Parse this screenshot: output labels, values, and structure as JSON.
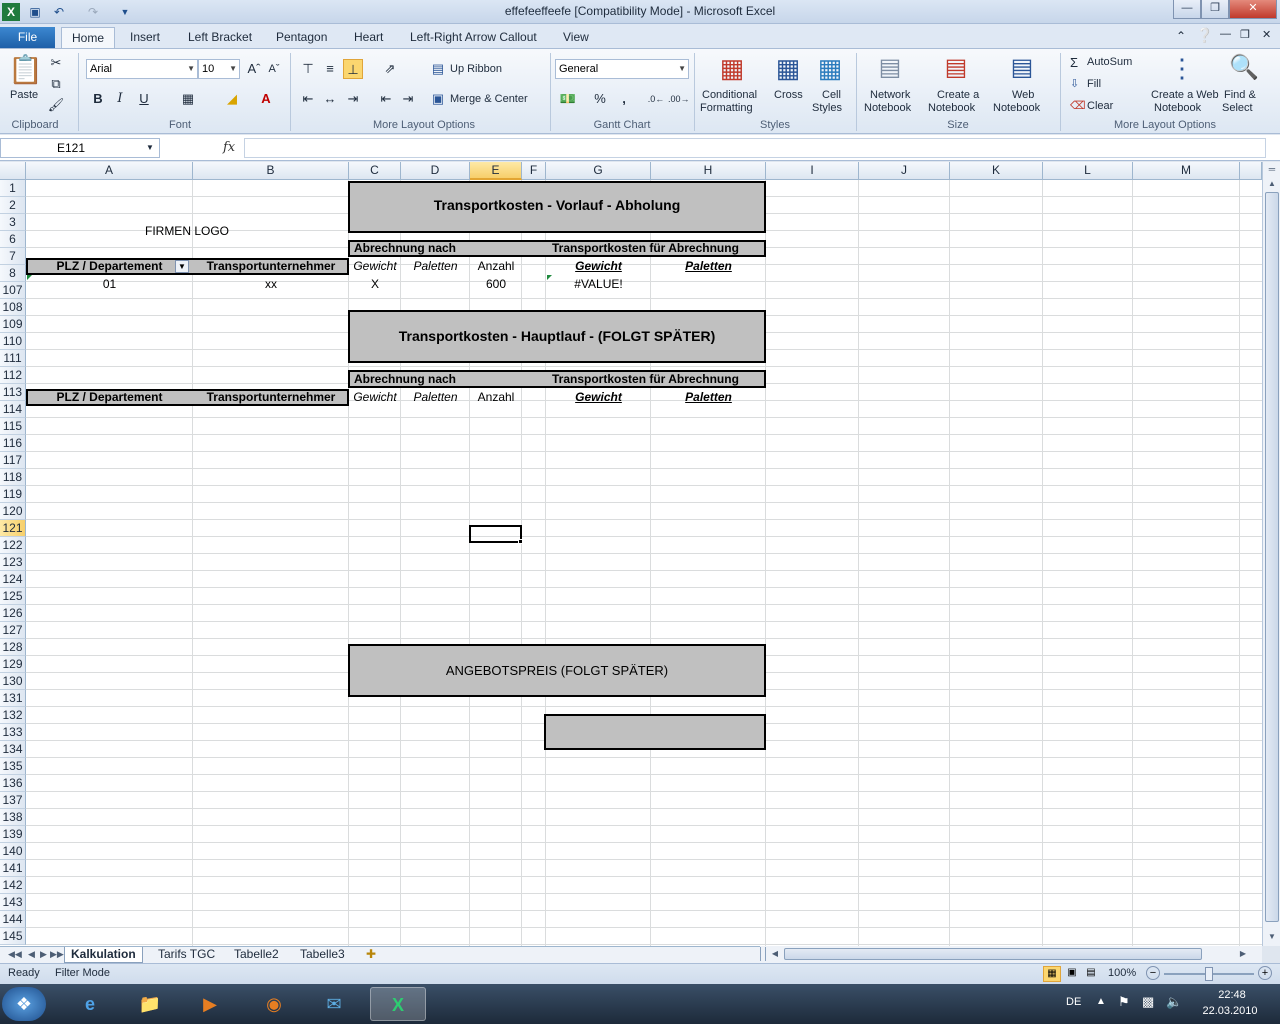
{
  "window": {
    "title": "effefeeffeefe  [Compatibility Mode]  -  Microsoft Excel"
  },
  "tabs": [
    "File",
    "Home",
    "Insert",
    "Left Bracket",
    "Pentagon",
    "Heart",
    "Left-Right Arrow Callout",
    "View"
  ],
  "ribbon": {
    "clipboard": {
      "paste": "Paste",
      "label": "Clipboard"
    },
    "font": {
      "name": "Arial",
      "size": "10",
      "label": "Font",
      "bold": "B",
      "italic": "I",
      "underline": "U"
    },
    "layout1": {
      "up_ribbon": "Up Ribbon",
      "merge_center": "Merge & Center",
      "label": "More Layout Options"
    },
    "number": {
      "format": "General",
      "label": "Gantt Chart",
      "percent": "%",
      "comma": ","
    },
    "styles": {
      "cond1": "Conditional",
      "cond2": "Formatting",
      "cross": "Cross",
      "cell1": "Cell",
      "cell2": "Styles",
      "label": "Styles"
    },
    "size": {
      "net1": "Network",
      "net2": "Notebook",
      "create1": "Create a",
      "create2": "Notebook",
      "web1": "Web",
      "web2": "Notebook",
      "label": "Size"
    },
    "editing": {
      "autosum": "AutoSum",
      "fill": "Fill",
      "clear": "Clear",
      "cw1": "Create a Web",
      "cw2": "Notebook",
      "find1": "Find &",
      "find2": "Select",
      "label": "More Layout Options"
    }
  },
  "formula_bar": {
    "name_box": "E121",
    "fx": "fx",
    "content": ""
  },
  "columns": [
    "A",
    "B",
    "C",
    "D",
    "E",
    "F",
    "G",
    "H",
    "I",
    "J",
    "K",
    "L",
    "M"
  ],
  "rows": [
    "1",
    "2",
    "3",
    "6",
    "7",
    "8",
    "107",
    "108",
    "109",
    "110",
    "111",
    "112",
    "113",
    "114",
    "115",
    "116",
    "117",
    "118",
    "119",
    "120",
    "121",
    "122",
    "123",
    "124",
    "125",
    "126",
    "127",
    "128",
    "129",
    "130",
    "131",
    "132",
    "133",
    "134",
    "135",
    "136",
    "137",
    "138",
    "139",
    "140",
    "141",
    "142",
    "143",
    "144",
    "145"
  ],
  "sheet": {
    "logo": "FIRMEN LOGO",
    "section1_title": "Transportkosten  - Vorlauf - Abholung",
    "section2_title": "Transportkosten  - Hauptlauf - (FOLGT SPÄTER)",
    "offer_title": "ANGEBOTSPREIS (FOLGT SPÄTER)",
    "abrechnung_nach": "Abrechnung nach",
    "tk_fuer_abrechnung": "Transportkosten für Abrechnung",
    "hdr_plz": "PLZ / Departement",
    "hdr_tu": "Transportunternehmer",
    "hdr_gewicht": "Gewicht",
    "hdr_paletten": "Paletten",
    "hdr_anzahl": "Anzahl",
    "row8": {
      "plz": "01",
      "tu": "xx",
      "gewicht": "X",
      "anzahl": "600",
      "result": "#VALUE!"
    }
  },
  "sheet_tabs": [
    "Kalkulation",
    "Tarifs TGC",
    "Tabelle2",
    "Tabelle3"
  ],
  "status": {
    "ready": "Ready",
    "mode": "Filter Mode",
    "zoom": "100%"
  },
  "taskbar": {
    "lang": "DE",
    "time": "22:48",
    "date": "22.03.2010"
  }
}
